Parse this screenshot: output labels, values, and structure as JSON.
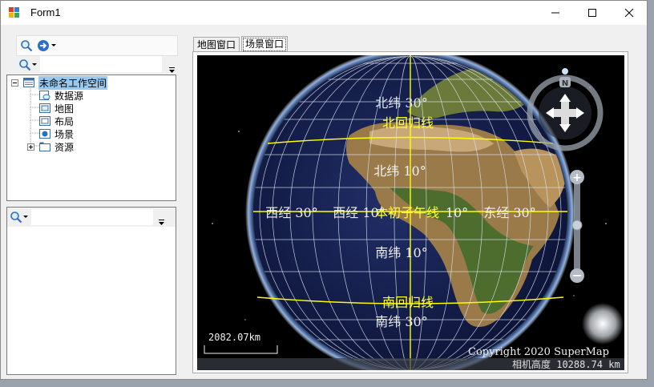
{
  "window": {
    "title": "Form1"
  },
  "workspace_tree": {
    "root": "未命名工作空间",
    "items": [
      "数据源",
      "地图",
      "布局",
      "场景",
      "资源"
    ]
  },
  "tabs": [
    {
      "label": "地图窗口",
      "active": false
    },
    {
      "label": "场景窗口",
      "active": true
    }
  ],
  "scene": {
    "graticule_labels": {
      "lat_n30": "北纬 30°",
      "tropic_cancer": "北回归线",
      "lat_n10": "北纬 10°",
      "lon_w30": "西经 30°",
      "lon_w10": "西经 10°",
      "prime_meridian": "本初子午线",
      "lon_e10": "10°",
      "lon_e30": "东经 30°",
      "lat_s10": "南纬 10°",
      "tropic_capricorn": "南回归线",
      "lat_s30": "南纬 30°"
    },
    "scale_text": "2082.07km",
    "copyright": "Copyright 2020 SuperMap",
    "camera_height": "相机高度 10288.74 km",
    "compass_label": "N"
  },
  "colors": {
    "graticule": "#ffff00",
    "ocean": "#15204a",
    "selection": "#99c9ef"
  }
}
